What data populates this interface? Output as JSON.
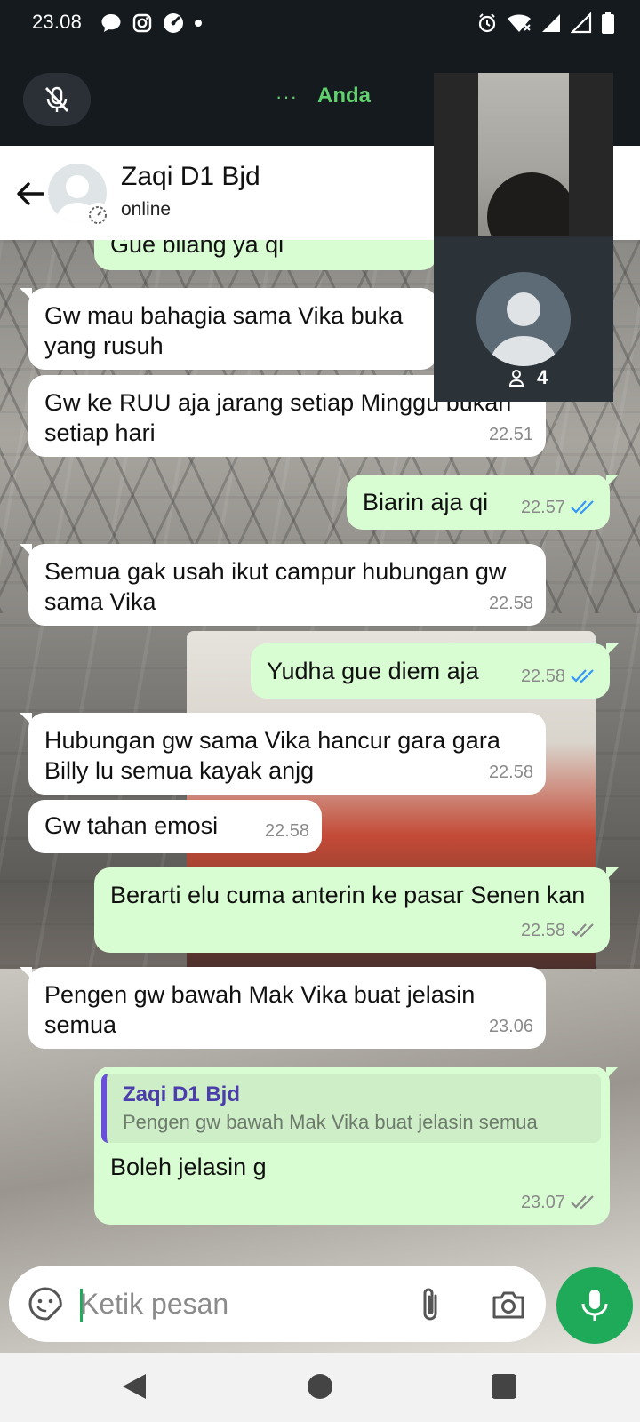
{
  "status_bar": {
    "time": "23.08",
    "left_icons": [
      "chat-bubble-icon",
      "instagram-icon",
      "speedometer-icon",
      "dot-icon"
    ],
    "right_icons": [
      "alarm-icon",
      "wifi-icon",
      "signal-icon",
      "signal-icon",
      "battery-icon"
    ]
  },
  "call": {
    "dots": "···",
    "name": "Anda",
    "accent_color": "#62d06f",
    "participants_count": "4"
  },
  "header": {
    "contact_name": "Zaqi D1 Bjd",
    "status": "online"
  },
  "messages": [
    {
      "dir": "out",
      "text": "Gue bilang ya qi",
      "time": ""
    },
    {
      "dir": "in",
      "text": "Gw mau bahagia sama  Vika buka yang rusuh",
      "time": ""
    },
    {
      "dir": "in",
      "text": "Gw ke RUU aja jarang setiap Minggu bukan setiap hari",
      "time": "22.51"
    },
    {
      "dir": "out",
      "text": "Biarin aja qi",
      "time": "22.57",
      "ticks": "read"
    },
    {
      "dir": "in",
      "text": "Semua gak usah ikut campur hubungan gw sama Vika",
      "time": "22.58"
    },
    {
      "dir": "out",
      "text": "Yudha gue diem aja",
      "time": "22.58",
      "ticks": "read"
    },
    {
      "dir": "in",
      "text": "Hubungan gw sama Vika hancur gara gara Billy lu semua kayak anjg",
      "time": "22.58"
    },
    {
      "dir": "in",
      "text": "Gw tahan emosi",
      "time": "22.58"
    },
    {
      "dir": "out",
      "text": "Berarti elu cuma anterin ke pasar Senen kan",
      "time": "22.58",
      "ticks": "delivered"
    },
    {
      "dir": "in",
      "text": "Pengen gw bawah Mak Vika buat jelasin semua",
      "time": "23.06"
    },
    {
      "dir": "out",
      "text": "Boleh jelasin g",
      "time": "23.07",
      "ticks": "delivered",
      "quote": {
        "name": "Zaqi D1 Bjd",
        "text": "Pengen gw bawah Mak Vika buat jelasin semua"
      }
    }
  ],
  "input": {
    "placeholder": "Ketik pesan"
  },
  "colors": {
    "outgoing_bubble": "#d9fdd3",
    "incoming_bubble": "#ffffff",
    "read_ticks": "#3497f9",
    "fab": "#1faa59"
  }
}
